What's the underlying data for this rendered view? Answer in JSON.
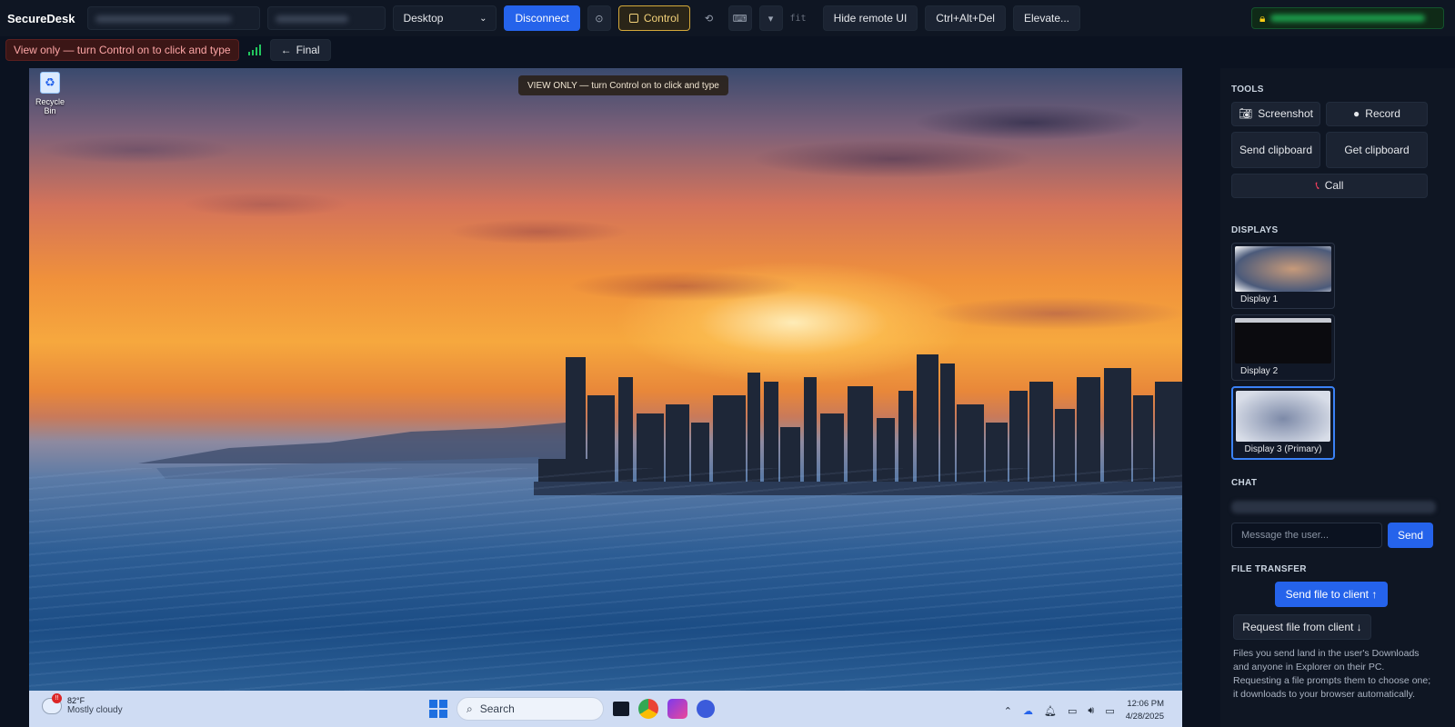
{
  "app": {
    "brand": "SecureDesk"
  },
  "toolbar": {
    "session_select": "Desktop",
    "disconnect": "Disconnect",
    "control": "Control",
    "fit": "fit",
    "hide_remote_ui": "Hide remote UI",
    "ctrl_alt_del": "Ctrl+Alt+Del",
    "elevate": "Elevate..."
  },
  "status": {
    "view_only_warning": "View only — turn Control on to click and type",
    "quality_button": "Final"
  },
  "remote": {
    "desktop_icon": "Recycle Bin",
    "toast": "VIEW ONLY — turn Control on to click and type",
    "taskbar": {
      "weather_temp": "82°F",
      "weather_desc": "Mostly cloudy",
      "weather_badge": "!!",
      "search_label": "Search",
      "time": "12:06 PM",
      "date": "4/28/2025"
    }
  },
  "sidebar": {
    "tools_title": "TOOLS",
    "tools": {
      "screenshot": "Screenshot",
      "record": "Record",
      "send_clipboard": "Send clipboard",
      "get_clipboard": "Get clipboard",
      "call": "Call"
    },
    "displays_title": "DISPLAYS",
    "displays": [
      {
        "label": "Display 1"
      },
      {
        "label": "Display 2"
      },
      {
        "label": "Display 3 (Primary)"
      }
    ],
    "chat_title": "CHAT",
    "chat_placeholder": "Message the user...",
    "chat_send": "Send",
    "file_title": "FILE TRANSFER",
    "send_file": "Send file to client ↑",
    "request_file": "Request file from client ↓",
    "file_note": "Files you send land in the user's Downloads and anyone in Explorer on their PC. Requesting a file prompts them to choose one; it downloads to your browser automatically."
  },
  "colors": {
    "accent": "#2563eb",
    "control_border": "#d4a93a",
    "warning_bg": "#3b1616",
    "secure_green": "#22c55e"
  }
}
